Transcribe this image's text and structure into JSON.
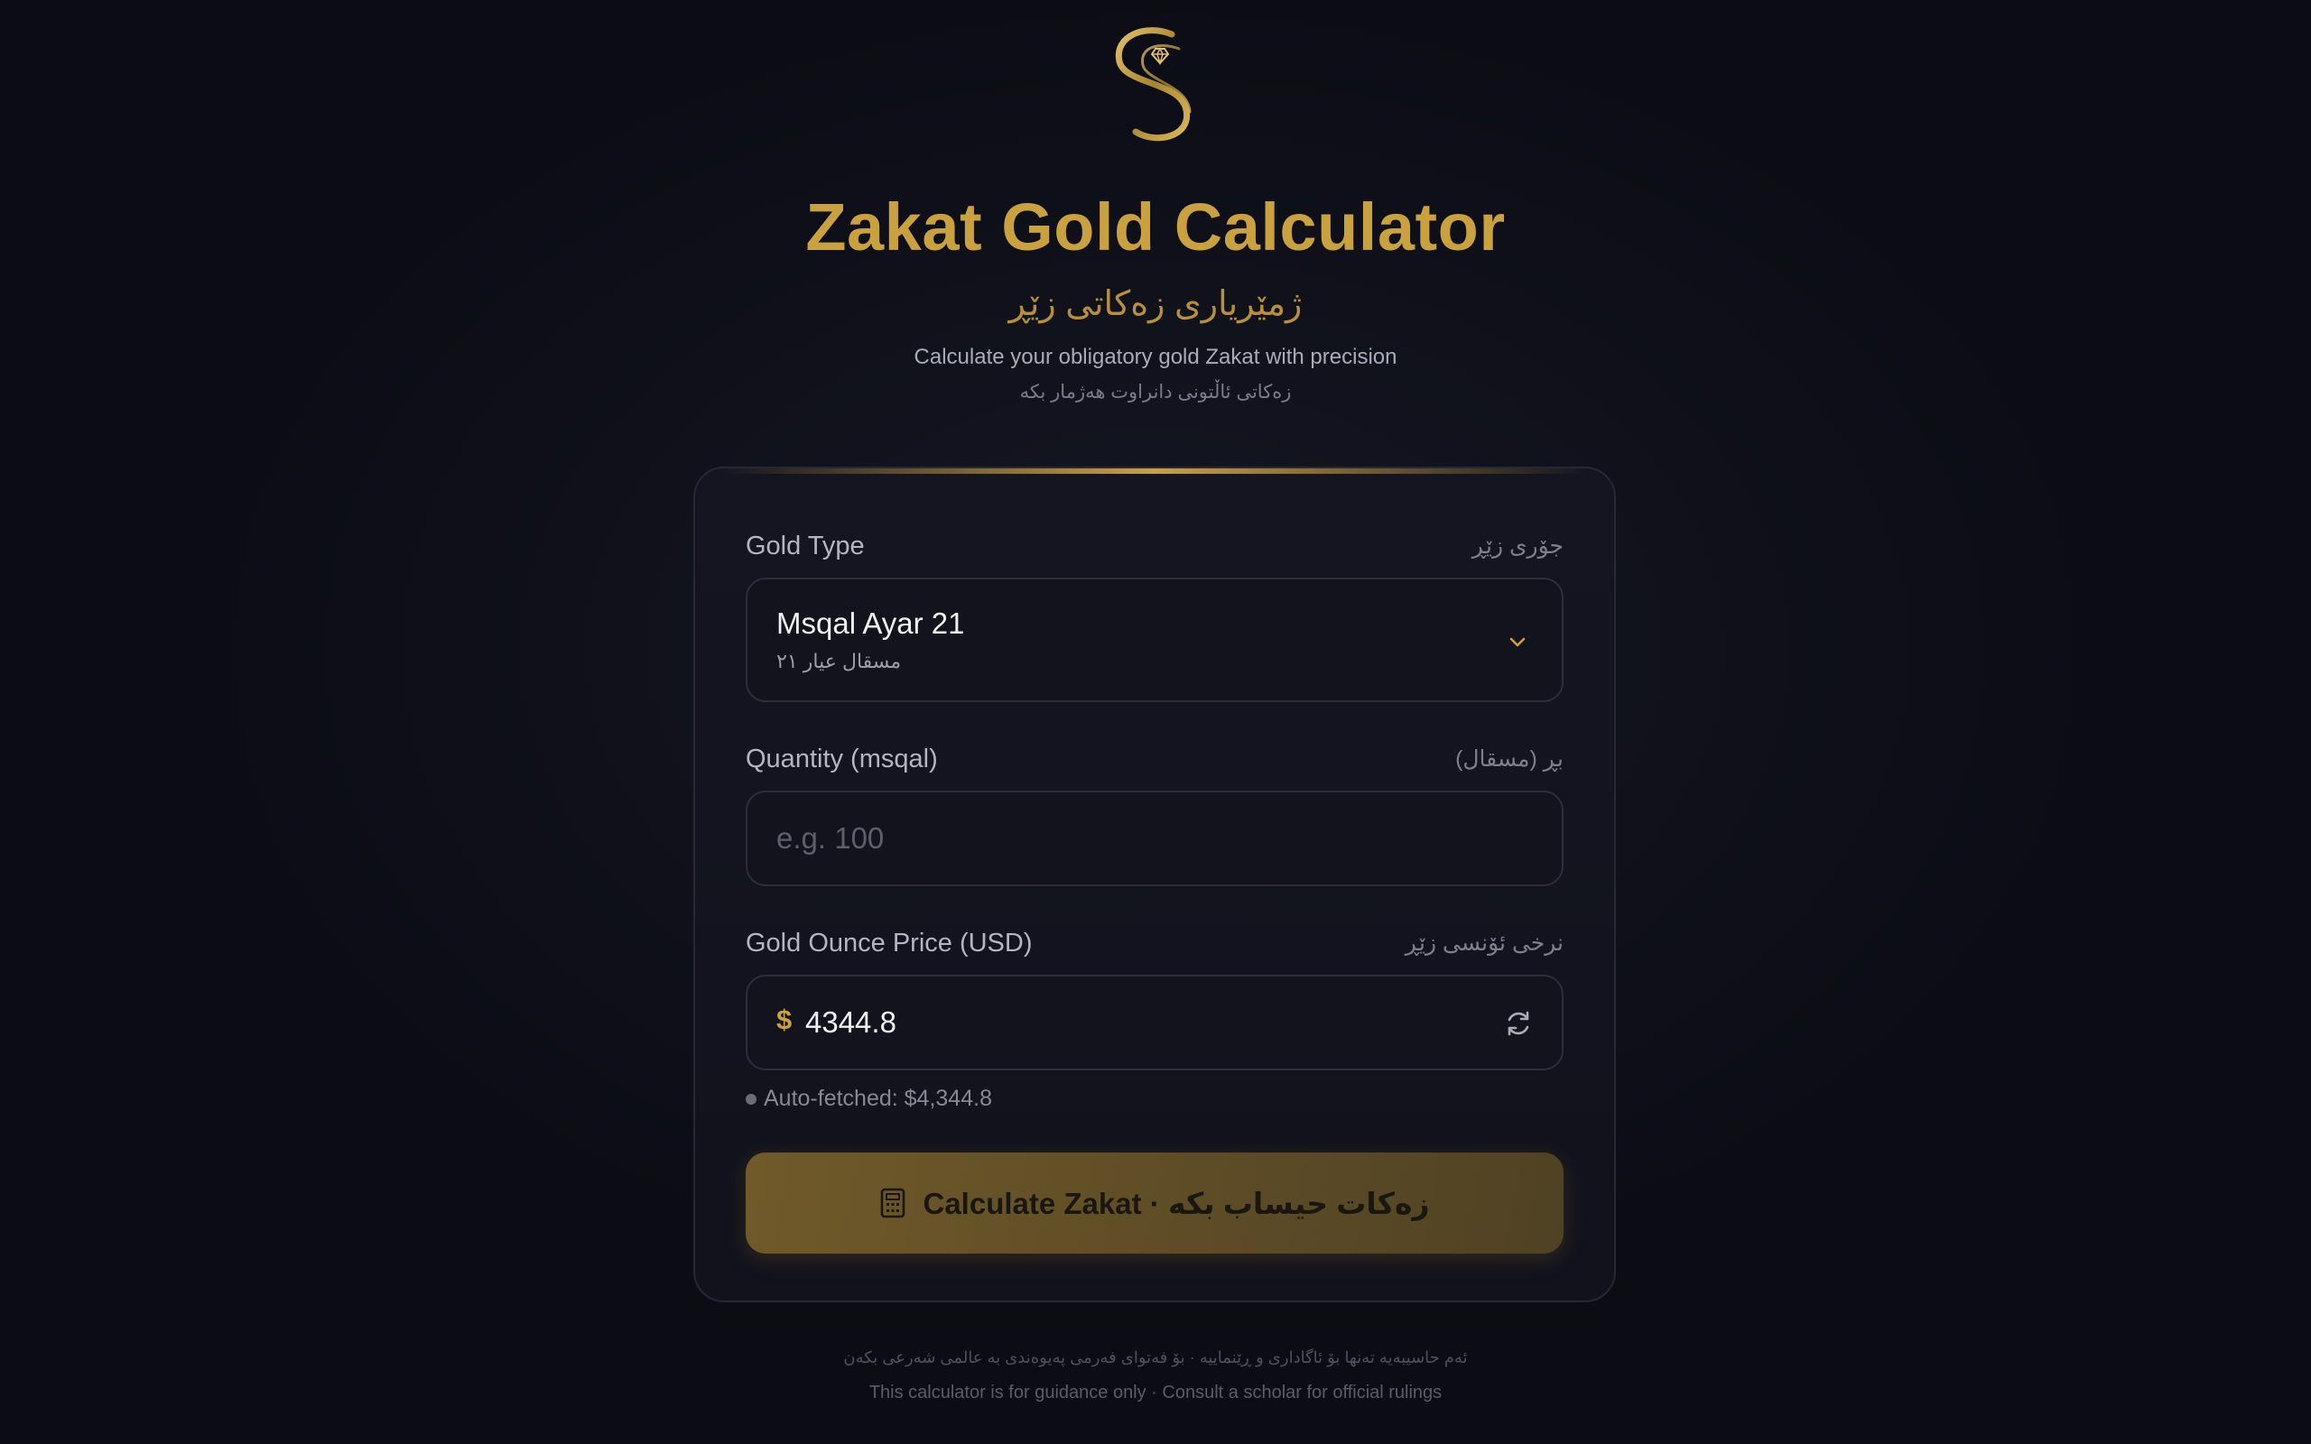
{
  "header": {
    "title": "Zakat Gold Calculator",
    "subtitle_ku": "ژمێریاری زەکاتی زێڕ",
    "tagline": "Calculate your obligatory gold Zakat with precision",
    "tagline_ku": "زەکاتی ئاڵتونی دانراوت هەژمار بکە"
  },
  "form": {
    "gold_type": {
      "label": "Gold Type",
      "label_ku": "جۆری زێڕ",
      "selected": "Msqal Ayar 21",
      "selected_ku": "مسقال عيار ٢١",
      "icon": "chevron-down-icon"
    },
    "quantity": {
      "label": "Quantity (msqal)",
      "label_ku": "بڕ (مسقال)",
      "value": "",
      "placeholder": "e.g. 100"
    },
    "ounce_price": {
      "label": "Gold Ounce Price (USD)",
      "label_ku": "نرخی ئۆنسی زێڕ",
      "currency_symbol": "$",
      "value": "4344.8",
      "auto_fetched": "Auto-fetched: $4,344.8",
      "icon": "refresh-icon"
    },
    "calculate_button": {
      "label": "Calculate Zakat · زەکات حیساب بکە",
      "icon": "calculator-icon"
    }
  },
  "footer": {
    "disclaimer_ku": "ئەم حاسیبەیە تەنها بۆ ئاگاداری و ڕێنماییە · بۆ فەتوای فەرمی پەیوەندی بە عالمی شەرعی بکەن",
    "disclaimer": "This calculator is for guidance only · Consult a scholar for official rulings"
  },
  "colors": {
    "background": "#0b0c14",
    "accent_gold": "#c9a13f",
    "card": "#141521",
    "button": "#6a5529"
  }
}
